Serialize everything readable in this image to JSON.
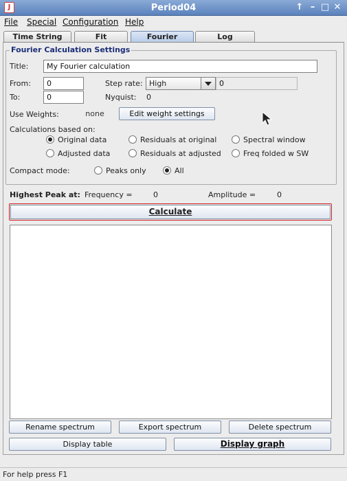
{
  "window": {
    "title": "Period04",
    "app_icon": "java-icon"
  },
  "window_controls": {
    "up_symbol": "↑",
    "minimize_symbol": "–",
    "maximize_symbol": "□",
    "close_symbol": "✕"
  },
  "menu": [
    "File",
    "Special",
    "Configuration",
    "Help"
  ],
  "tabs": [
    {
      "label": "Time String",
      "active": false
    },
    {
      "label": "Fit",
      "active": false
    },
    {
      "label": "Fourier",
      "active": true
    },
    {
      "label": "Log",
      "active": false
    }
  ],
  "fourier_settings": {
    "group_title": "Fourier Calculation Settings",
    "title_label": "Title:",
    "title_value": "My Fourier calculation",
    "from_label": "From:",
    "from_value": "0",
    "to_label": "To:",
    "to_value": "0",
    "step_rate_label": "Step rate:",
    "step_rate_value": "High",
    "step_rate_extra_value": "0",
    "nyquist_label": "Nyquist:",
    "nyquist_value": "0",
    "use_weights_label": "Use Weights:",
    "weights_value": "none",
    "edit_weights_button": "Edit weight settings",
    "based_on_label": "Calculations based on:",
    "based_on_options": [
      {
        "label": "Original data",
        "checked": true
      },
      {
        "label": "Residuals at original",
        "checked": false
      },
      {
        "label": "Spectral window",
        "checked": false
      },
      {
        "label": "Adjusted data",
        "checked": false
      },
      {
        "label": "Residuals at adjusted",
        "checked": false
      },
      {
        "label": "Freq folded w SW",
        "checked": false
      }
    ],
    "compact_mode_label": "Compact mode:",
    "compact_options": [
      {
        "label": "Peaks only",
        "checked": false
      },
      {
        "label": "All",
        "checked": true
      }
    ]
  },
  "results": {
    "highest_peak_label": "Highest Peak at:",
    "frequency_label": "Frequency =",
    "frequency_value": "0",
    "amplitude_label": "Amplitude =",
    "amplitude_value": "0"
  },
  "buttons": {
    "calculate": "Calculate",
    "rename_spectrum": "Rename spectrum",
    "export_spectrum": "Export spectrum",
    "delete_spectrum": "Delete spectrum",
    "display_table": "Display table",
    "display_graph": "Display graph"
  },
  "status": {
    "text": "For help press F1"
  }
}
